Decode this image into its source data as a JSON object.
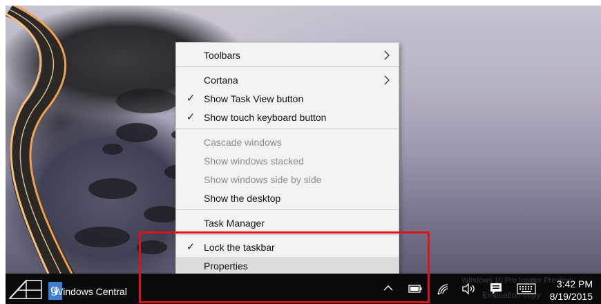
{
  "menu": {
    "items": [
      {
        "label": "Toolbars",
        "checked": false,
        "submenu": true,
        "disabled": false
      },
      {
        "label": "Cortana",
        "checked": false,
        "submenu": true,
        "disabled": false
      },
      {
        "label": "Show Task View button",
        "checked": true,
        "submenu": false,
        "disabled": false
      },
      {
        "label": "Show touch keyboard button",
        "checked": true,
        "submenu": false,
        "disabled": false
      },
      {
        "label": "Cascade windows",
        "checked": false,
        "submenu": false,
        "disabled": true
      },
      {
        "label": "Show windows stacked",
        "checked": false,
        "submenu": false,
        "disabled": true
      },
      {
        "label": "Show windows side by side",
        "checked": false,
        "submenu": false,
        "disabled": true
      },
      {
        "label": "Show the desktop",
        "checked": false,
        "submenu": false,
        "disabled": false
      },
      {
        "label": "Task Manager",
        "checked": false,
        "submenu": false,
        "disabled": false
      },
      {
        "label": "Lock the taskbar",
        "checked": true,
        "submenu": false,
        "disabled": false
      },
      {
        "label": "Properties",
        "checked": false,
        "submenu": false,
        "disabled": false,
        "hovered": true
      }
    ],
    "check_glyph": "✓"
  },
  "taskbar": {
    "brand_text": "Windows Central",
    "brand_badge_glyph": "g",
    "clock_time": "3:42 PM",
    "clock_date": "8/19/2015",
    "watermark_line1": "Windows 10 Pro Insider Preview",
    "watermark_line2": "Evaluation copy",
    "tray_icons": [
      "chevron-up-icon",
      "battery-icon",
      "wifi-icon",
      "volume-icon",
      "action-center-icon",
      "keyboard-icon"
    ]
  },
  "colors": {
    "highlight": "#e01018",
    "taskbar": "#0a0a0c",
    "menu_bg": "#f2f2f2",
    "brand_blue": "#3d7fd6"
  }
}
